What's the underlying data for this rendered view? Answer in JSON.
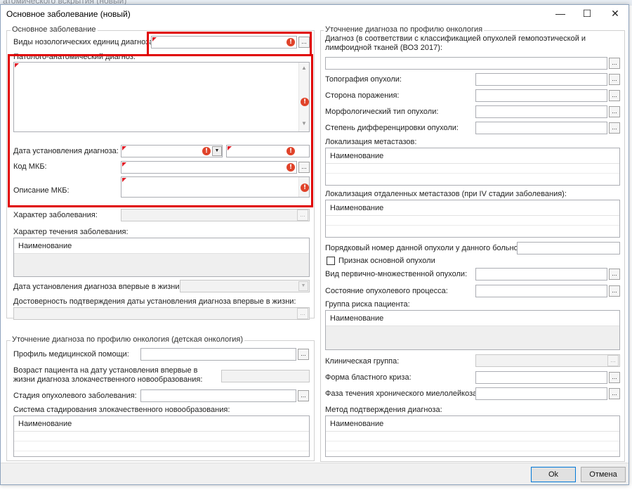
{
  "background_title": "атомического вскрытия (новый)",
  "window": {
    "title": "Основное заболевание (новый)",
    "minimize_icon": "—",
    "maximize_icon": "☐",
    "close_icon": "✕"
  },
  "icons": {
    "dots": "...",
    "error": "!",
    "dropdown": "▼"
  },
  "left": {
    "main_group": {
      "legend": "Основное заболевание",
      "nosology_label": "Виды нозологических единиц диагноза:",
      "pathoanatomic_label": "Патолого-анатомический диагноз:",
      "diag_date_label": "Дата установления диагноза:",
      "mkb_code_label": "Код МКБ:",
      "mkb_desc_label": "Описание МКБ:",
      "disease_nature_label": "Характер заболевания:",
      "disease_course_label": "Характер течения заболевания:",
      "course_list_header": "Наименование",
      "first_diag_date_label": "Дата установления диагноза впервые в жизни:",
      "date_reliability_label": "Достоверность подтверждения даты установления диагноза впервые в жизни:"
    },
    "child_onco_group": {
      "legend": "Уточнение диагноза по профилю онкология (детская онкология)",
      "med_profile_label": "Профиль медицинской помощи:",
      "age_label": "Возраст пациента на дату установления впервые в жизни диагноза злокачественного новообразования:",
      "stage_label": "Стадия опухолевого заболевания:",
      "staging_system_label": "Система стадирования злокачественного новообразования:",
      "staging_list_header": "Наименование"
    }
  },
  "right": {
    "legend": "Уточнение диагноза по профилю онкология",
    "diagnosis_who_label": "Диагноз (в соответствии с классификацией опухолей гемопоэтической и лимфоидной тканей (ВОЗ 2017):",
    "topography_label": "Топография опухоли:",
    "lesion_side_label": "Сторона поражения:",
    "morphology_label": "Морфологический тип опухоли:",
    "differentiation_label": "Степень дифференцировки опухоли:",
    "metastasis_label": "Локализация метастазов:",
    "metastasis_list_header": "Наименование",
    "distant_metastasis_label": "Локализация отдаленных метастазов (при IV стадии заболевания):",
    "distant_list_header": "Наименование",
    "tumor_number_label": "Порядковый номер данной опухоли у данного больного:",
    "main_tumor_checkbox_label": "Признак основной опухоли",
    "multiple_tumor_label": "Вид первично-множественной опухоли:",
    "tumor_state_label": "Состояние опухолевого процесса:",
    "risk_group_label": "Группа риска пациента:",
    "risk_list_header": "Наименование",
    "clinical_group_label": "Клиническая группа:",
    "blast_crisis_label": "Форма бластного криза:",
    "cml_phase_label": "Фаза течения хронического миелолейкоза:",
    "confirmation_method_label": "Метод подтверждения диагноза:",
    "confirmation_list_header": "Наименование"
  },
  "footer": {
    "ok_label": "Ok",
    "cancel_label": "Отмена"
  }
}
